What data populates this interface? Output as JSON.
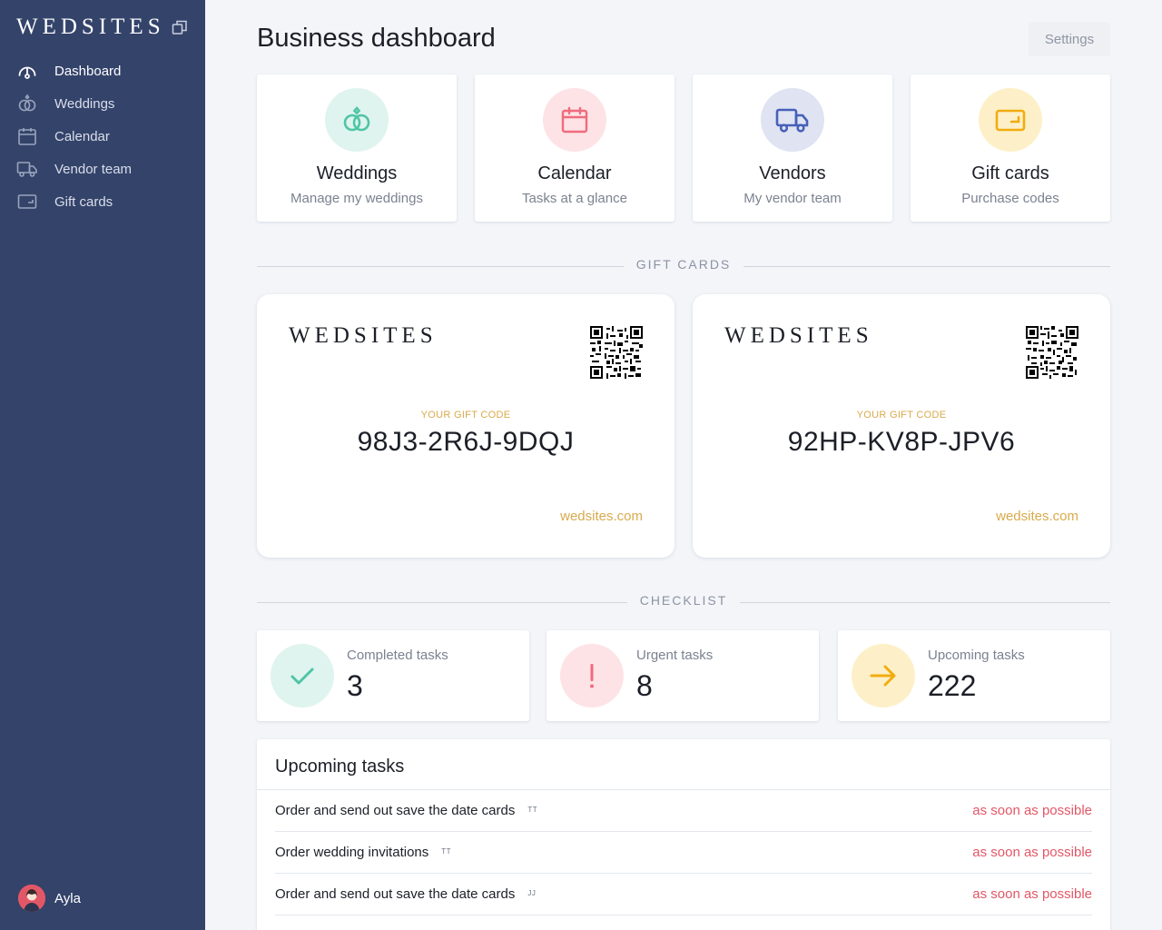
{
  "sidebar": {
    "logo": "WEDSITES",
    "items": [
      {
        "label": "Dashboard",
        "icon": "dashboard-gauge-icon"
      },
      {
        "label": "Weddings",
        "icon": "rings-icon"
      },
      {
        "label": "Calendar",
        "icon": "calendar-icon"
      },
      {
        "label": "Vendor team",
        "icon": "truck-icon"
      },
      {
        "label": "Gift cards",
        "icon": "gift-card-icon"
      }
    ],
    "user": {
      "name": "Ayla"
    }
  },
  "header": {
    "title": "Business dashboard",
    "settings_label": "Settings"
  },
  "tiles": [
    {
      "title": "Weddings",
      "subtitle": "Manage my weddings",
      "icon": "rings-icon",
      "color": "#4fc5a6",
      "bg": "#dff4ee"
    },
    {
      "title": "Calendar",
      "subtitle": "Tasks at a glance",
      "icon": "calendar-icon",
      "color": "#ef6b7d",
      "bg": "#fde3e6"
    },
    {
      "title": "Vendors",
      "subtitle": "My vendor team",
      "icon": "truck-icon",
      "color": "#4760b8",
      "bg": "#dfe3f2"
    },
    {
      "title": "Gift cards",
      "subtitle": "Purchase codes",
      "icon": "gift-card-icon",
      "color": "#f2ac10",
      "bg": "#fdf0c8"
    }
  ],
  "gift_section": {
    "title": "GIFT CARDS"
  },
  "gift_cards": [
    {
      "brand": "WEDSITES",
      "label": "YOUR GIFT CODE",
      "code": "98J3-2R6J-9DQJ",
      "site": "wedsites.com"
    },
    {
      "brand": "WEDSITES",
      "label": "YOUR GIFT CODE",
      "code": "92HP-KV8P-JPV6",
      "site": "wedsites.com"
    }
  ],
  "checklist_section": {
    "title": "CHECKLIST"
  },
  "stats": [
    {
      "label": "Completed tasks",
      "value": "3",
      "icon": "check-icon",
      "color": "#4fc5a6",
      "bg": "#dff4ee"
    },
    {
      "label": "Urgent tasks",
      "value": "8",
      "icon": "exclamation-icon",
      "color": "#ef6b7d",
      "bg": "#fde3e6"
    },
    {
      "label": "Upcoming tasks",
      "value": "222",
      "icon": "arrow-right-icon",
      "color": "#f2ac10",
      "bg": "#fdf0c8"
    }
  ],
  "upcoming": {
    "title": "Upcoming tasks",
    "rows": [
      {
        "name": "Order and send out save the date cards",
        "tag": "TT",
        "due": "as soon as possible"
      },
      {
        "name": "Order wedding invitations",
        "tag": "TT",
        "due": "as soon as possible"
      },
      {
        "name": "Order and send out save the date cards",
        "tag": "JJ",
        "due": "as soon as possible"
      }
    ]
  }
}
